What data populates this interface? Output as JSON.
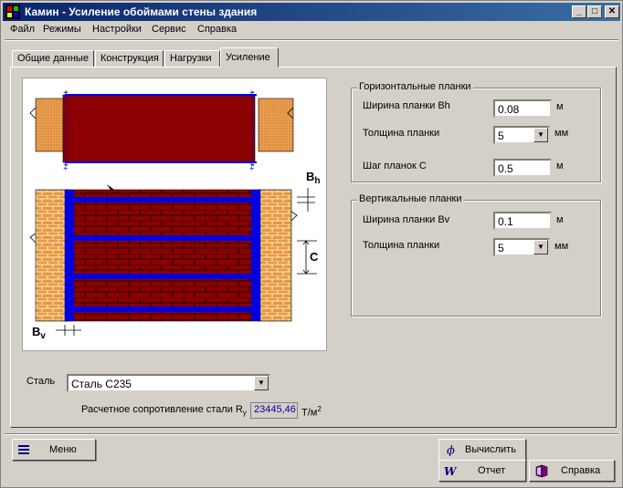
{
  "window": {
    "title": "Камин - Усиление обоймами стены здания",
    "minimize_glyph": "_",
    "maximize_glyph": "□",
    "close_glyph": "✕"
  },
  "menu": [
    "Файл",
    "Режимы",
    "Настройки",
    "Сервис",
    "Справка"
  ],
  "tabs": [
    "Общие данные",
    "Конструкция",
    "Нагрузки",
    "Усиление"
  ],
  "active_tab": "Усиление",
  "drawing": {
    "label_bh": "B",
    "label_bh_sub": "h",
    "label_c": "C",
    "label_bv": "B",
    "label_bv_sub": "v",
    "colors": {
      "brick": "#8b0000",
      "steel": "#0000e0",
      "side_brick": "#e89a3c"
    }
  },
  "horizontal": {
    "title": "Горизонтальные планки",
    "width_label": "Ширина планки Bh",
    "width_value": "0.08",
    "width_unit": "м",
    "thickness_label": "Толщина планки",
    "thickness_value": "5",
    "thickness_unit": "мм",
    "step_label": "Шаг планок С",
    "step_value": "0.5",
    "step_unit": "м"
  },
  "vertical": {
    "title": "Вертикальные планки",
    "width_label": "Ширина планки Bv",
    "width_value": "0.1",
    "width_unit": "м",
    "thickness_label": "Толщина планки",
    "thickness_value": "5",
    "thickness_unit": "мм"
  },
  "steel": {
    "label": "Сталь",
    "value": "Сталь С235",
    "resistance_label": "Расчетное сопротивление стали R",
    "resistance_sub": "y",
    "resistance_value": "23445,46",
    "resistance_unit": "Т/м",
    "resistance_unit_sup": "2"
  },
  "buttons": {
    "menu": "Меню",
    "calculate": "Вычислить",
    "report": "Отчет",
    "help": "Справка"
  }
}
